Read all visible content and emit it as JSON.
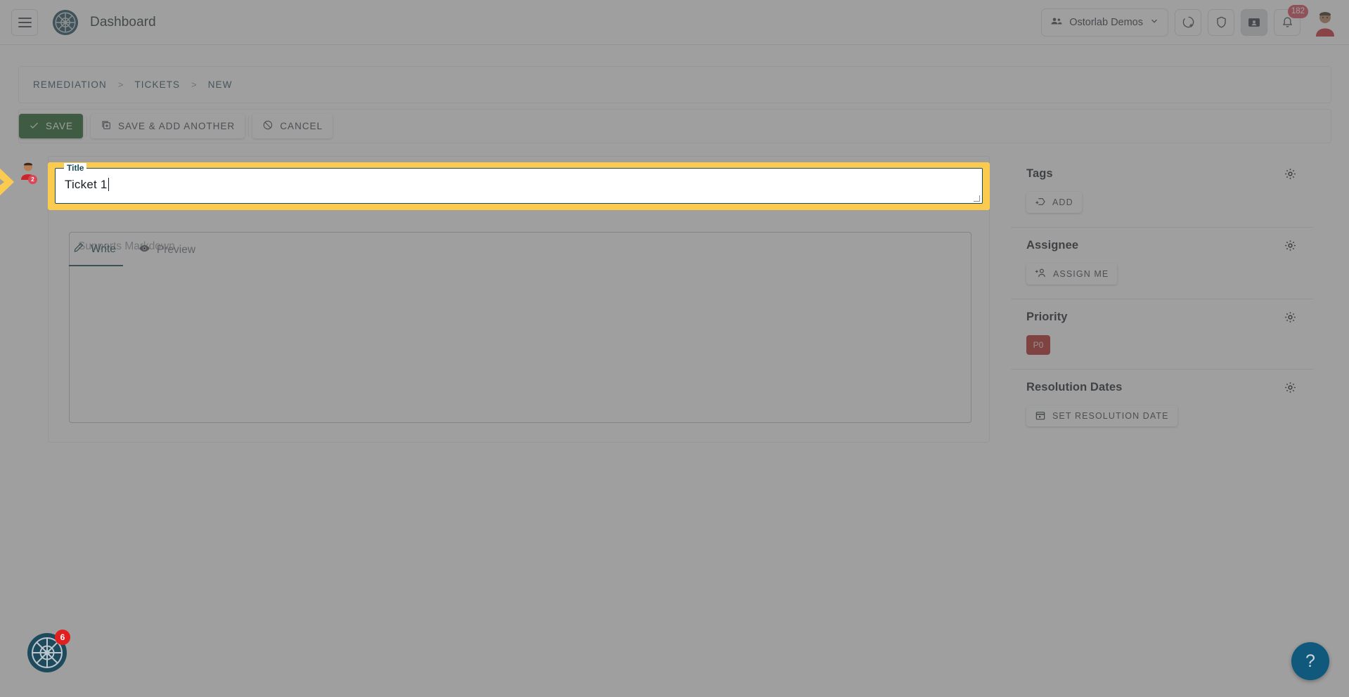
{
  "header": {
    "menu_icon": "hamburger-icon",
    "logo_icon": "ostorlab-logo-icon",
    "title": "Dashboard",
    "org_selector": {
      "icon": "group-icon",
      "label": "Ostorlab Demos",
      "chevron": "chevron-down-icon"
    },
    "icons": [
      {
        "name": "scan-add-icon",
        "label": "New Scan"
      },
      {
        "name": "shield-icon",
        "label": "Security"
      },
      {
        "name": "id-card-icon",
        "label": "Tickets"
      }
    ],
    "notifications": {
      "icon": "bell-icon",
      "count": "182"
    },
    "avatar": {
      "name": "user-avatar",
      "badge": ""
    }
  },
  "breadcrumb": {
    "items": [
      "REMEDIATION",
      "TICKETS",
      "NEW"
    ],
    "separator": ">"
  },
  "actions": {
    "save": {
      "label": "SAVE",
      "icon": "check-icon"
    },
    "save_add_another": {
      "label": "SAVE & ADD ANOTHER",
      "icon": "copy-add-icon"
    },
    "cancel": {
      "label": "CANCEL",
      "icon": "block-icon"
    }
  },
  "form": {
    "title_field": {
      "legend": "Title",
      "value": "Ticket 1",
      "highlighted": true,
      "highlight_color": "#FACB4F",
      "border_color": "#1D4A5C"
    },
    "description": {
      "tabs": [
        {
          "label": "Write",
          "icon": "pencil-icon",
          "active": true
        },
        {
          "label": "Preview",
          "icon": "eye-icon",
          "active": false
        }
      ],
      "placeholder": "Supports Markdown",
      "value": ""
    }
  },
  "sidebar": {
    "sections": [
      {
        "title": "Tags",
        "gear_icon": "gear-icon",
        "action": {
          "label": "ADD",
          "icon": "tag-add-icon"
        }
      },
      {
        "title": "Assignee",
        "gear_icon": "gear-icon",
        "action": {
          "label": "ASSIGN ME",
          "icon": "person-add-icon"
        }
      },
      {
        "title": "Priority",
        "gear_icon": "gear-icon",
        "chip": {
          "label": "P0",
          "color": "#B3281F"
        }
      },
      {
        "title": "Resolution Dates",
        "gear_icon": "gear-icon",
        "action": {
          "label": "SET RESOLUTION DATE",
          "icon": "calendar-icon"
        }
      }
    ]
  },
  "floating": {
    "corner_logo": {
      "icon": "ostorlab-logo-icon",
      "badge": "6"
    },
    "help": {
      "icon": "question-mark-icon",
      "label": "?"
    }
  },
  "cursor": {
    "pointer_icon": "yellow-arrow-pointer",
    "avatar_badge": "2"
  }
}
